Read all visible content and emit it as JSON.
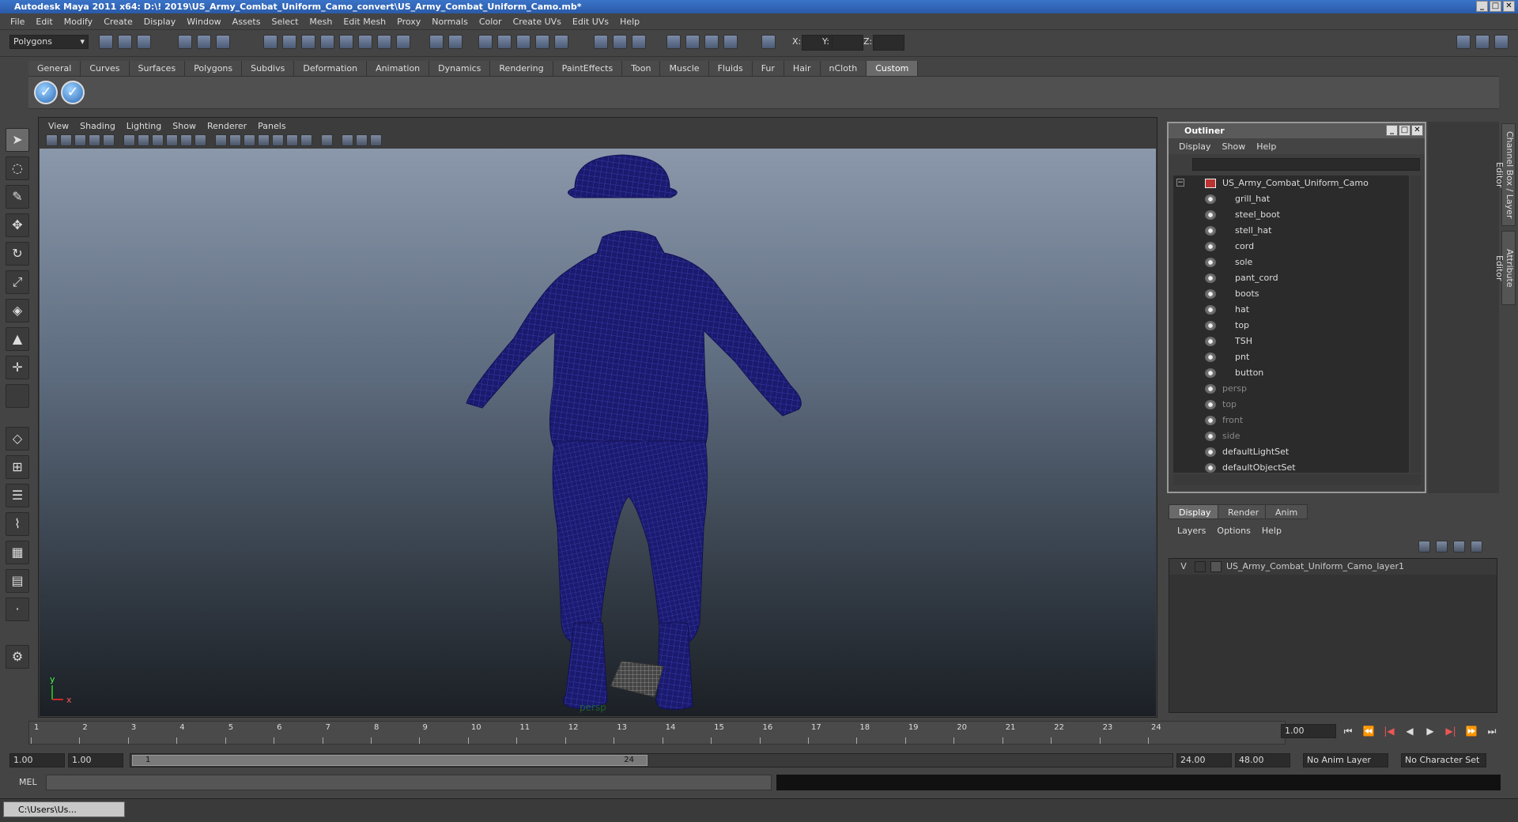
{
  "window": {
    "title": "Autodesk Maya 2011 x64: D:\\! 2019\\US_Army_Combat_Uniform_Camo_convert\\US_Army_Combat_Uniform_Camo.mb*"
  },
  "menubar": [
    "File",
    "Edit",
    "Modify",
    "Create",
    "Display",
    "Window",
    "Assets",
    "Select",
    "Mesh",
    "Edit Mesh",
    "Proxy",
    "Normals",
    "Color",
    "Create UVs",
    "Edit UVs",
    "Help"
  ],
  "toolbar": {
    "mode": "Polygons",
    "x_label": "X:",
    "y_label": "Y:",
    "z_label": "Z:"
  },
  "shelf_tabs": [
    "General",
    "Curves",
    "Surfaces",
    "Polygons",
    "Subdivs",
    "Deformation",
    "Animation",
    "Dynamics",
    "Rendering",
    "PaintEffects",
    "Toon",
    "Muscle",
    "Fluids",
    "Fur",
    "Hair",
    "nCloth",
    "Custom"
  ],
  "shelf_active": "Custom",
  "viewport": {
    "menu": [
      "View",
      "Shading",
      "Lighting",
      "Show",
      "Renderer",
      "Panels"
    ],
    "camera_label": "persp",
    "axis_y": "y",
    "axis_x": "x",
    "wire_color": "#1a1a7a"
  },
  "outliner": {
    "title": "Outliner",
    "menu": [
      "Display",
      "Show",
      "Help"
    ],
    "root": "US_Army_Combat_Uniform_Camo",
    "children": [
      "grill_hat",
      "steel_boot",
      "stell_hat",
      "cord",
      "sole",
      "pant_cord",
      "boots",
      "hat",
      "top",
      "TSH",
      "pnt",
      "button"
    ],
    "cameras": [
      "persp",
      "top",
      "front",
      "side"
    ],
    "sets": [
      "defaultLightSet",
      "defaultObjectSet"
    ]
  },
  "layers": {
    "tabs": [
      "Display",
      "Render",
      "Anim"
    ],
    "menu": [
      "Layers",
      "Options",
      "Help"
    ],
    "layer_visible": "V",
    "layer_name": "US_Army_Combat_Uniform_Camo_layer1"
  },
  "side_tabs": [
    "Channel Box / Layer Editor",
    "Attribute Editor"
  ],
  "timeline": {
    "ticks": [
      "1",
      "2",
      "3",
      "4",
      "5",
      "6",
      "7",
      "8",
      "9",
      "10",
      "11",
      "12",
      "13",
      "14",
      "15",
      "16",
      "17",
      "18",
      "19",
      "20",
      "21",
      "22",
      "23",
      "24"
    ],
    "current_frame": "1.00",
    "start_marker": "1"
  },
  "range": {
    "start": "1.00",
    "playback_start": "1.00",
    "bar_start": "1",
    "bar_end": "24",
    "playback_end": "24.00",
    "end": "48.00",
    "anim_layer": "No Anim Layer",
    "char_set": "No Character Set"
  },
  "cmdline": {
    "label": "MEL"
  },
  "taskbar": {
    "item": "C:\\Users\\Us..."
  }
}
